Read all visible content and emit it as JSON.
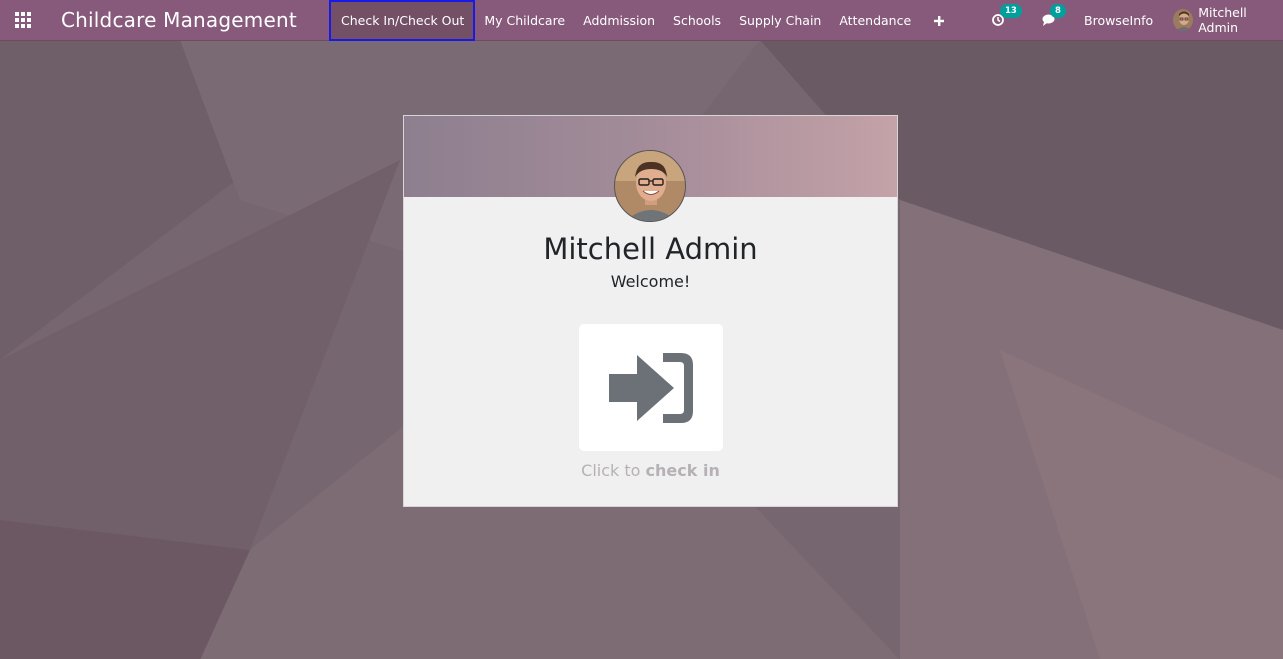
{
  "navbar": {
    "app_title": "Childcare Management",
    "menu": [
      {
        "label": "Check In/Check Out",
        "active": true
      },
      {
        "label": "My Childcare"
      },
      {
        "label": "Addmission"
      },
      {
        "label": "Schools"
      },
      {
        "label": "Supply Chain"
      },
      {
        "label": "Attendance"
      }
    ],
    "plus_icon": "plus-icon",
    "systray": {
      "activity_count": "13",
      "messages_count": "8",
      "company": "BrowseInfo",
      "user_name": "Mitchell Admin"
    }
  },
  "card": {
    "employee_name": "Mitchell Admin",
    "greeting": "Welcome!",
    "hint_prefix": "Click to",
    "hint_action": "check in",
    "button_icon": "sign-in-icon"
  },
  "colors": {
    "navbar": "#875a7b",
    "badge": "#00a09d",
    "icon": "#6c757d"
  }
}
